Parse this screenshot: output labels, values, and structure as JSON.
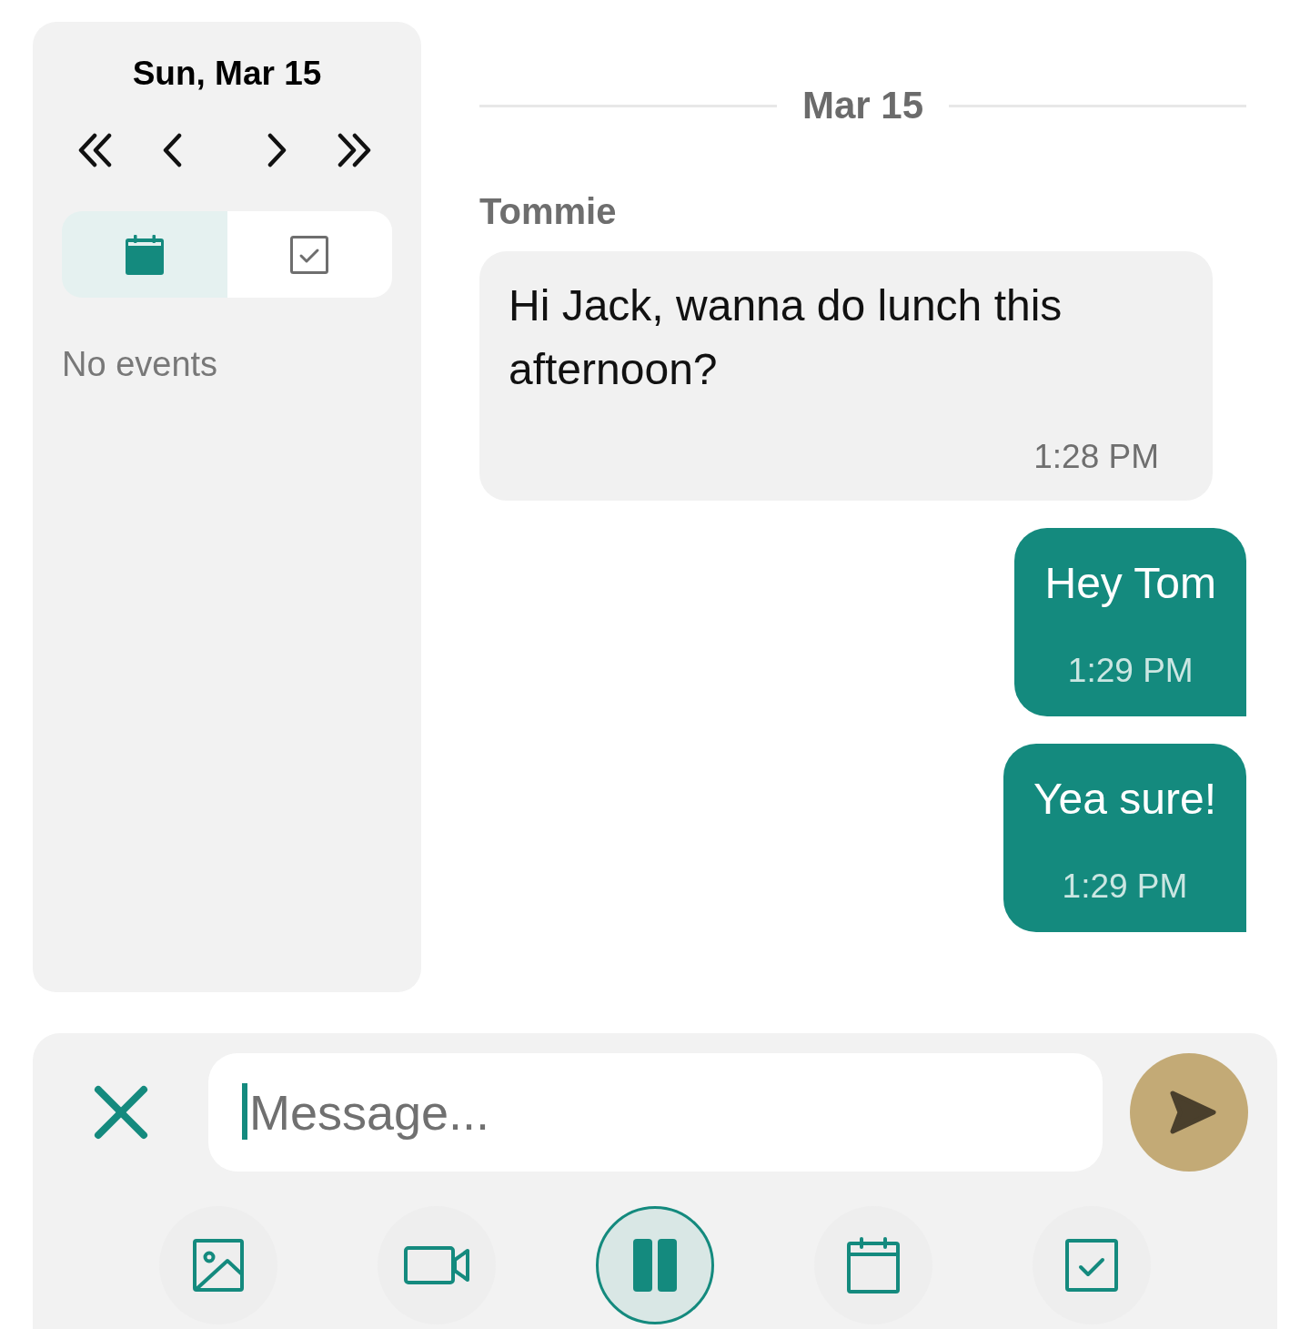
{
  "sidebar": {
    "title": "Sun, Mar 15",
    "view_tabs": [
      {
        "kind": "calendar",
        "selected": true
      },
      {
        "kind": "tasks",
        "selected": false
      }
    ],
    "empty_message": "No events"
  },
  "chat": {
    "date_divider": "Mar 15",
    "messages": [
      {
        "kind": "incoming",
        "sender": "Tommie",
        "text": "Hi Jack, wanna do lunch this afternoon?",
        "time": "1:28 PM"
      },
      {
        "kind": "outgoing",
        "text": "Hey Tom",
        "time": "1:29 PM"
      },
      {
        "kind": "outgoing",
        "text": "Yea sure!",
        "time": "1:29 PM"
      }
    ]
  },
  "composer": {
    "placeholder": "Message...",
    "tools": [
      {
        "kind": "image"
      },
      {
        "kind": "video"
      },
      {
        "kind": "pause"
      },
      {
        "kind": "calendar"
      },
      {
        "kind": "tasks"
      }
    ]
  }
}
